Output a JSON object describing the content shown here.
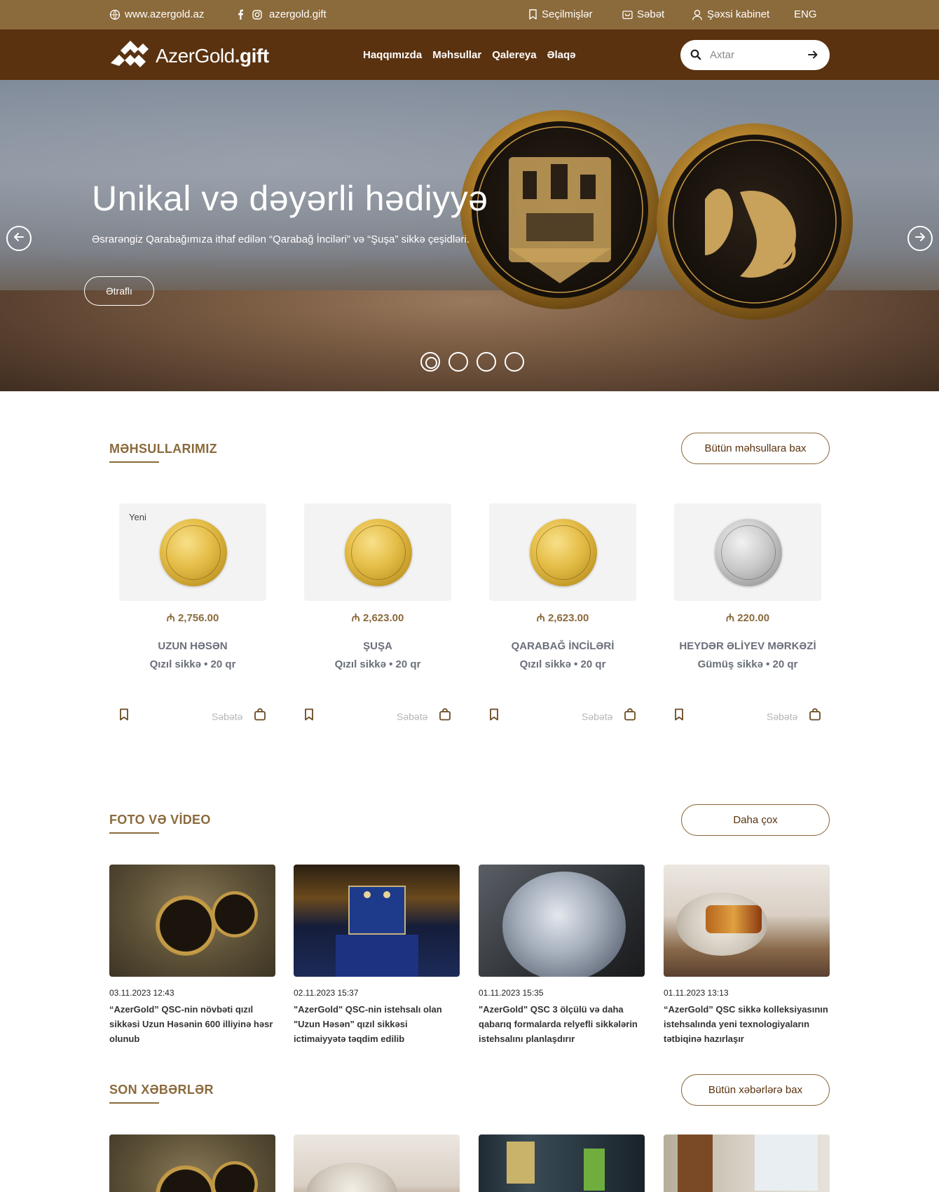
{
  "topbar": {
    "website": "www.azergold.az",
    "social_handle": "azergold.gift",
    "favorites": "Seçilmişlər",
    "cart": "Səbət",
    "account": "Şəxsi kabinet",
    "language": "ENG"
  },
  "nav": {
    "logo_main": "AzerGold",
    "logo_suffix": ".gift",
    "menu": [
      "Haqqımızda",
      "Məhsullar",
      "Qalereya",
      "Əlaqə"
    ],
    "search_placeholder": "Axtar"
  },
  "hero": {
    "title": "Unikal və dəyərli hədiyyə",
    "subtitle": "Əsrarəngiz Qarabağımıza ithaf edilən “Qarabağ İnciləri” və “Şuşa” sikkə çeşidləri.",
    "button": "Ətraflı",
    "slides_total": 4,
    "active_slide": 1
  },
  "products_section": {
    "title": "MƏHSULLARIMIZ",
    "button": "Bütün məhsullara bax",
    "cart_label": "Səbətə",
    "items": [
      {
        "badge": "Yeni",
        "price": "₼ 2,756.00",
        "name": "UZUN HƏSƏN",
        "desc": "Qızıl sikkə • 20 qr",
        "metal": "gold"
      },
      {
        "badge": "",
        "price": "₼ 2,623.00",
        "name": "ŞUŞA",
        "desc": "Qızıl sikkə • 20 qr",
        "metal": "gold"
      },
      {
        "badge": "",
        "price": "₼ 2,623.00",
        "name": "QARABAĞ İNCİLƏRİ",
        "desc": "Qızıl sikkə • 20 qr",
        "metal": "gold"
      },
      {
        "badge": "",
        "price": "₼ 220.00",
        "name": "HEYDƏR ƏLİYEV MƏRKƏZİ",
        "desc": "Gümüş sikkə • 20 qr",
        "metal": "silver"
      }
    ]
  },
  "media_section": {
    "title": "FOTO VƏ VİDEO",
    "button": "Daha çox",
    "items": [
      {
        "date": "03.11.2023 12:43",
        "title": "“AzerGold” QSC-nin növbəti qızıl sikkəsi Uzun Həsənin 600 illiyinə həsr olunub"
      },
      {
        "date": "02.11.2023 15:37",
        "title": "\"AzerGold\" QSC-nin istehsalı olan \"Uzun Həsən\" qızıl sikkəsi ictimaiyyətə təqdim edilib"
      },
      {
        "date": "01.11.2023 15:35",
        "title": "\"AzerGold\" QSC 3 ölçülü və daha qabarıq formalarda relyefli sikkələrin istehsalını planlaşdırır"
      },
      {
        "date": "01.11.2023 13:13",
        "title": "“AzerGold” QSC sikkə kolleksiyasının istehsalında yeni texnologiyaların tətbiqinə hazırlaşır"
      }
    ]
  },
  "news_section": {
    "title": "SON XƏBƏRLƏR",
    "button": "Bütün xəbərlərə bax"
  },
  "colors": {
    "topbar": "#8b6a3c",
    "navbar": "#5a320f",
    "accent": "#8b6a3c"
  }
}
